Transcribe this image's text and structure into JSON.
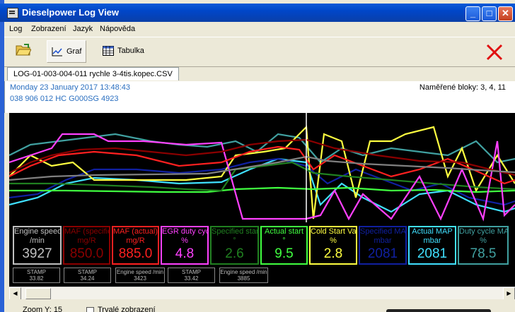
{
  "window": {
    "title": "Dieselpower Log View",
    "controls": {
      "minimize": "_",
      "maximize": "□",
      "close": "✕"
    }
  },
  "menu": [
    "Log",
    "Zobrazení",
    "Jazyk",
    "Nápověda"
  ],
  "toolbar": {
    "open_icon": "folder-open-icon",
    "graph_label": "Graf",
    "table_label": "Tabulka",
    "close_icon": "red-x-icon"
  },
  "tab": {
    "label": "LOG-01-003-004-011 rychle 3-4tis.kopec.CSV"
  },
  "info": {
    "date": "Monday 23 January 2017 13:48:43",
    "ecu": "038 906 012 HC  G000SG  4923",
    "blocks": "Naměřené bloky: 3, 4, 11"
  },
  "channels": [
    {
      "name": "Engine speed",
      "unit": "/min",
      "value": "3927",
      "color": "#c0c0c0"
    },
    {
      "name": "MAF (specified)",
      "unit": "mg/R",
      "value": "850.0",
      "color": "#8b0000"
    },
    {
      "name": "MAF (actual)",
      "unit": "mg/R",
      "value": "885.0",
      "color": "#ff2020"
    },
    {
      "name": "EGR duty cycle",
      "unit": "%",
      "value": "4.8",
      "color": "#ff40ff"
    },
    {
      "name": "Specified start",
      "unit": "°",
      "value": "2.6",
      "color": "#208020"
    },
    {
      "name": "Actual start",
      "unit": "°",
      "value": "9.5",
      "color": "#40ff40"
    },
    {
      "name": "Cold Start Valve",
      "unit": "%",
      "value": "2.8",
      "color": "#ffff40"
    },
    {
      "name": "Specified MAP",
      "unit": "mbar",
      "value": "2081",
      "color": "#1020a0"
    },
    {
      "name": "Actual MAP",
      "unit": "mbar",
      "value": "2081",
      "color": "#40e0ff"
    },
    {
      "name": "Duty cycle MAP valve",
      "unit": "%",
      "value": "78.5",
      "color": "#40a0a0"
    }
  ],
  "stamps": [
    {
      "label": "STAMP",
      "value": "33.82"
    },
    {
      "label": "STAMP",
      "value": "34.24"
    },
    {
      "label": "Engine speed /min",
      "value": "3423"
    },
    {
      "label": "STAMP",
      "value": "33.42"
    },
    {
      "label": "Engine speed /min",
      "value": "3885"
    }
  ],
  "status": {
    "zoom": "Zoom Y: 15",
    "checkbox_label": "Trvalé zobrazení"
  }
}
